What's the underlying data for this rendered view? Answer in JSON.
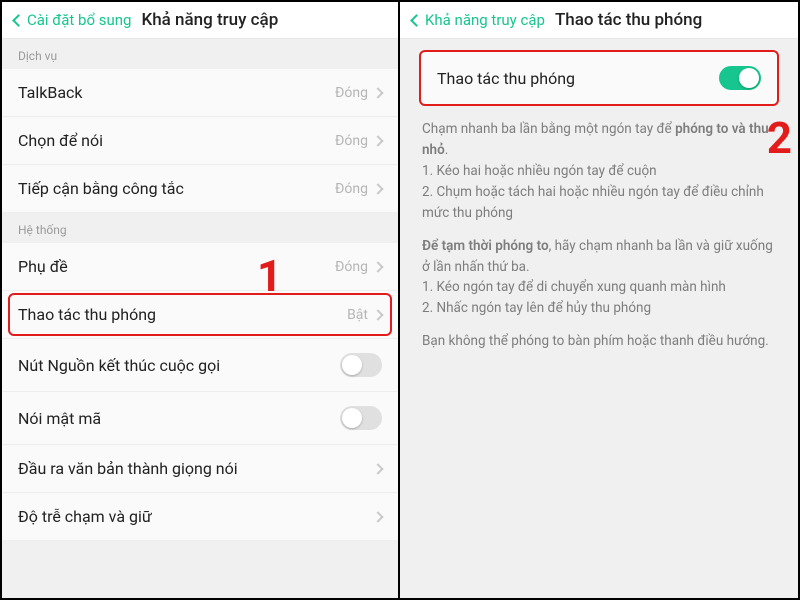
{
  "left": {
    "back": "Cài đặt bổ sung",
    "title": "Khả năng truy cập",
    "section_service": "Dịch vụ",
    "section_system": "Hệ thống",
    "rows": [
      {
        "label": "TalkBack",
        "status": "Đóng",
        "chev": true
      },
      {
        "label": "Chọn để nói",
        "status": "Đóng",
        "chev": true
      },
      {
        "label": "Tiếp cận bằng công tắc",
        "status": "Đóng",
        "chev": true
      },
      {
        "label": "Phụ đề",
        "status": "Đóng",
        "chev": true
      },
      {
        "label": "Thao tác thu phóng",
        "status": "Bật",
        "chev": true
      },
      {
        "label": "Nút Nguồn kết thúc cuộc gọi",
        "toggle": false
      },
      {
        "label": "Nói mật mã",
        "toggle": false
      },
      {
        "label": "Đầu ra văn bản thành giọng nói",
        "chev": true
      },
      {
        "label": "Độ trễ chạm và giữ",
        "chev": true
      }
    ],
    "anno": "1"
  },
  "right": {
    "back": "Khả năng truy cập",
    "title": "Thao tác thu phóng",
    "row_label": "Thao tác thu phóng",
    "anno": "2",
    "para1_pre": "Chạm nhanh ba lần bằng một ngón tay để ",
    "para1_bold": "phóng to và thu nhỏ",
    "para1_post": ".",
    "li1": "1. Kéo hai hoặc nhiều ngón tay để cuộn",
    "li2": "2. Chụm hoặc tách hai hoặc nhiều ngón tay để điều chỉnh mức thu phóng",
    "para2_bold": "Để tạm thời phóng to",
    "para2_rest": ", hãy chạm nhanh ba lần và giữ xuống ở lần nhấn thứ ba.",
    "li3": "1. Kéo ngón tay để di chuyển xung quanh màn hình",
    "li4": "2. Nhấc ngón tay lên để hủy thu phóng",
    "para3": "Bạn không thể phóng to bàn phím hoặc thanh điều hướng."
  }
}
